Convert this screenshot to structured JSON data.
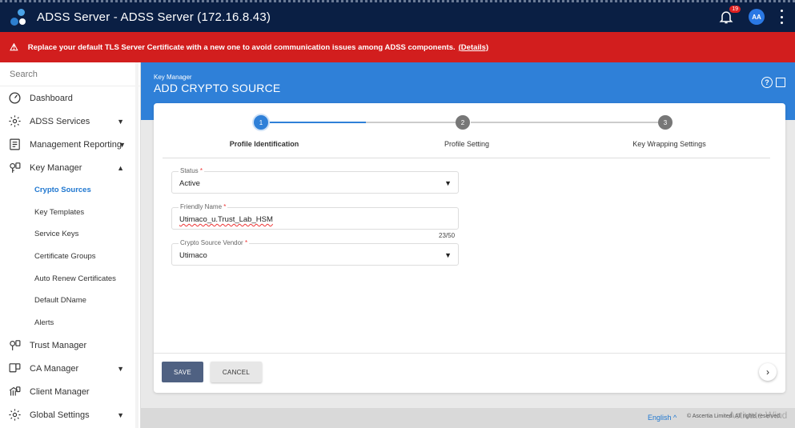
{
  "header": {
    "title": "ADSS Server - ADSS Server (172.16.8.43)",
    "notification_count": "19",
    "avatar_initials": "AA"
  },
  "alert": {
    "message": "Replace your default TLS Server Certificate with a new one to avoid communication issues among ADSS components.",
    "details_link": "(Details)"
  },
  "sidebar": {
    "search_placeholder": "Search",
    "items": [
      {
        "label": "Dashboard",
        "icon": "dashboard-icon"
      },
      {
        "label": "ADSS Services",
        "icon": "gear-icon",
        "chevron": "▼"
      },
      {
        "label": "Management Reporting",
        "icon": "report-icon",
        "chevron": "▼"
      },
      {
        "label": "Key Manager",
        "icon": "key-manager-icon",
        "chevron": "▲"
      }
    ],
    "sub_items": [
      {
        "label": "Crypto Sources",
        "active": true
      },
      {
        "label": "Key Templates"
      },
      {
        "label": "Service Keys"
      },
      {
        "label": "Certificate Groups"
      },
      {
        "label": "Auto Renew Certificates"
      },
      {
        "label": "Default DName"
      },
      {
        "label": "Alerts"
      }
    ],
    "items_after": [
      {
        "label": "Trust Manager",
        "icon": "trust-manager-icon"
      },
      {
        "label": "CA Manager",
        "icon": "ca-manager-icon",
        "chevron": "▼"
      },
      {
        "label": "Client Manager",
        "icon": "client-manager-icon"
      },
      {
        "label": "Global Settings",
        "icon": "global-settings-icon",
        "chevron": "▼"
      }
    ]
  },
  "page": {
    "breadcrumb": "Key Manager",
    "title": "ADD CRYPTO SOURCE"
  },
  "stepper": {
    "steps": [
      {
        "number": "1",
        "label": "Profile Identification",
        "active": true
      },
      {
        "number": "2",
        "label": "Profile Setting"
      },
      {
        "number": "3",
        "label": "Key Wrapping Settings"
      }
    ]
  },
  "form": {
    "status": {
      "label": "Status",
      "required_mark": "*",
      "value": "Active"
    },
    "friendly_name": {
      "label": "Friendly Name",
      "required_mark": "*",
      "value": "Utimaco_u.Trust_Lab_HSM",
      "counter": "23/50"
    },
    "vendor": {
      "label": "Crypto Source Vendor",
      "required_mark": "*",
      "value": "Utimaco"
    }
  },
  "footer": {
    "save_label": "SAVE",
    "cancel_label": "CANCEL",
    "next_glyph": "›"
  },
  "bottom": {
    "language": "English ^",
    "copyright": "© Ascertia Limited. All rights reserved.",
    "watermark": "Activate Wind"
  },
  "colors": {
    "header_bg": "#0a1f44",
    "alert_bg": "#d21e1e",
    "accent": "#2f80d8",
    "save_btn": "#4f6182"
  }
}
